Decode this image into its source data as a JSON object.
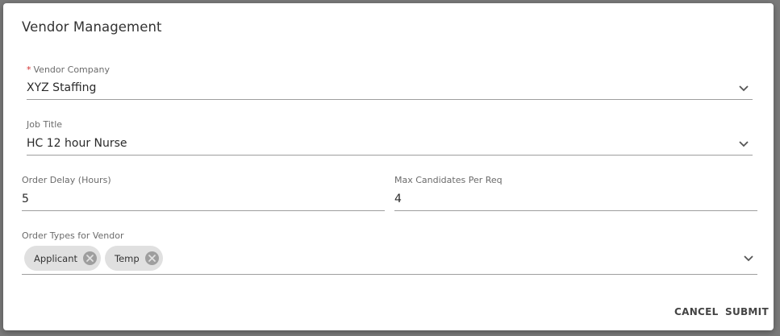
{
  "dialog": {
    "title": "Vendor Management"
  },
  "form": {
    "vendor_company": {
      "required_mark": "*",
      "label": "Vendor Company",
      "value": "XYZ Staffing"
    },
    "job_title": {
      "label": "Job Title",
      "value": "HC 12 hour Nurse"
    },
    "order_delay": {
      "label": "Order Delay (Hours)",
      "value": "5"
    },
    "max_candidates": {
      "label": "Max Candidates Per Req",
      "value": "4"
    },
    "order_types": {
      "label": "Order Types for Vendor",
      "chips": [
        {
          "label": "Applicant",
          "remove_icon": "cancel-circle-icon"
        },
        {
          "label": "Temp",
          "remove_icon": "cancel-circle-icon"
        }
      ]
    }
  },
  "actions": {
    "cancel_label": "CANCEL",
    "submit_label": "SUBMIT"
  },
  "icons": {
    "dropdown": "chevron-down-icon"
  },
  "colors": {
    "required": "#d32f2f",
    "chip_bg": "#e0e0e0",
    "chip_remove": "#9e9e9e"
  }
}
